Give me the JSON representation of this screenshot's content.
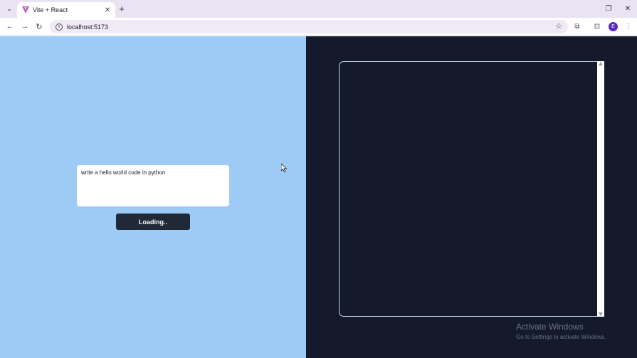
{
  "browser": {
    "tab": {
      "title": "Vite + React",
      "close_glyph": "✕"
    },
    "tab_list_glyph": "⌄",
    "new_tab_glyph": "+",
    "window_controls": {
      "restore": "❐",
      "close": "✕"
    },
    "nav": {
      "back": "←",
      "forward": "→",
      "reload": "↻"
    },
    "address": {
      "url": "localhost:5173",
      "info_glyph": "i",
      "bookmark_glyph": "☆"
    },
    "toolbar_icons": {
      "extensions": "⧉",
      "media": "⊡",
      "menu": "⋮"
    },
    "profile_initial": "E"
  },
  "app": {
    "prompt": {
      "value": "write a hello world code in python"
    },
    "submit_label": "Loading..",
    "colors": {
      "left_bg": "#9ecbf5",
      "right_bg": "#141a2b",
      "button_bg": "#1f2937"
    }
  },
  "os_watermark": {
    "title": "Activate Windows",
    "subtitle": "Go to Settings to activate Windows."
  }
}
